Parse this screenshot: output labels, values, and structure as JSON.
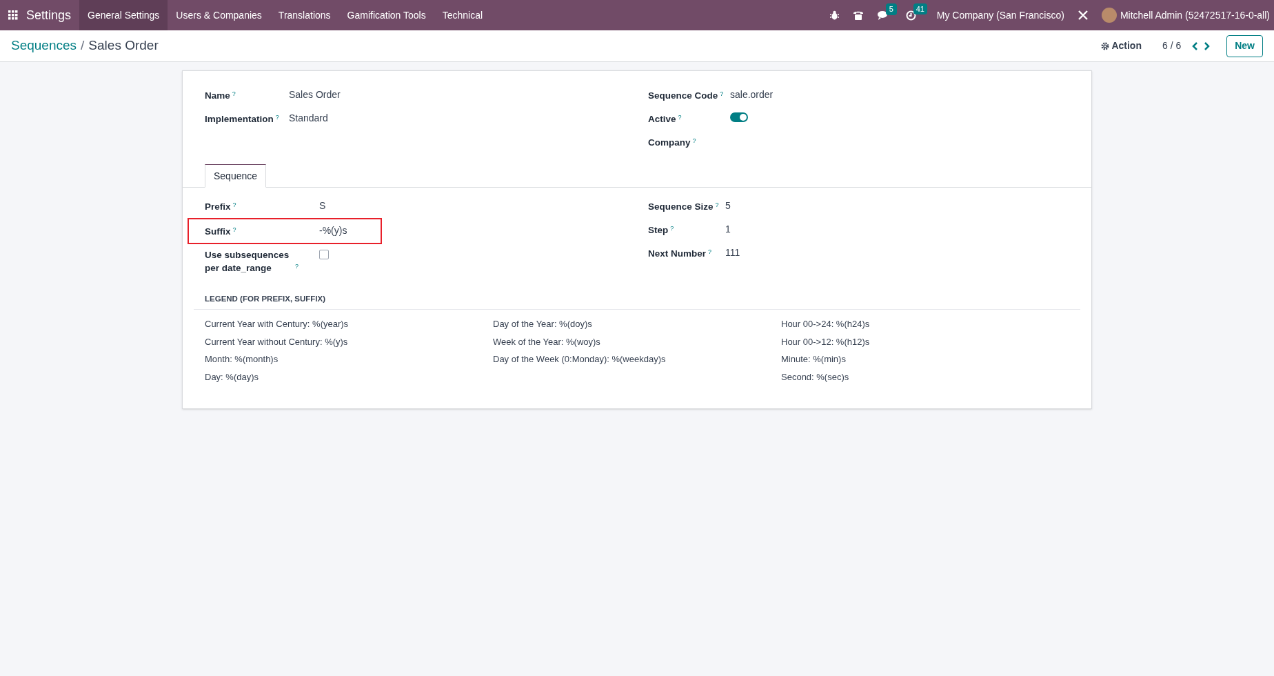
{
  "navbar": {
    "app_name": "Settings",
    "menus": [
      {
        "label": "General Settings",
        "selected": true
      },
      {
        "label": "Users & Companies",
        "selected": false
      },
      {
        "label": "Translations",
        "selected": false
      },
      {
        "label": "Gamification Tools",
        "selected": false
      },
      {
        "label": "Technical",
        "selected": false
      }
    ],
    "messages_count": "5",
    "activities_count": "41",
    "company": "My Company (San Francisco)",
    "user": "Mitchell Admin (52472517-16-0-all)"
  },
  "control_panel": {
    "breadcrumb": [
      {
        "label": "Sequences"
      },
      {
        "label": "Sales Order"
      }
    ],
    "separator": "/",
    "action": "Action",
    "pager": "6 / 6",
    "new_button": "New"
  },
  "form": {
    "left_fields": [
      {
        "kind": "text",
        "label": "Name",
        "help": "?",
        "value": "Sales Order"
      },
      {
        "kind": "text",
        "label": "Implementation",
        "help": "?",
        "value": "Standard"
      }
    ],
    "right_fields": [
      {
        "kind": "text",
        "label": "Sequence Code",
        "help": "?",
        "value": "sale.order"
      },
      {
        "kind": "toggle",
        "label": "Active",
        "help": "?",
        "on": true
      },
      {
        "kind": "empty",
        "label": "Company",
        "help": "?"
      }
    ],
    "tabs": [
      {
        "label": "Sequence",
        "selected": true
      }
    ],
    "tab_left_fields": [
      {
        "kind": "text",
        "label": "Prefix",
        "help": "?",
        "value": "S",
        "highlighted": false
      },
      {
        "kind": "text",
        "label": "Suffix",
        "help": "?",
        "value": "-%(y)s",
        "highlighted": true
      },
      {
        "kind": "checkbox",
        "label": "Use subsequences per date_range",
        "help": "?",
        "checked": false,
        "highlighted": false
      }
    ],
    "tab_right_fields": [
      {
        "kind": "text",
        "label": "Sequence Size",
        "help": "?",
        "value": "5"
      },
      {
        "kind": "text",
        "label": "Step",
        "help": "?",
        "value": "1"
      },
      {
        "kind": "text",
        "label": "Next Number",
        "help": "?",
        "value": "111"
      }
    ],
    "legend": {
      "title": "LEGEND (FOR PREFIX, SUFFIX)",
      "columns": [
        [
          "Current Year with Century: %(year)s",
          "Current Year without Century: %(y)s",
          "Month: %(month)s",
          "Day: %(day)s"
        ],
        [
          "Day of the Year: %(doy)s",
          "Week of the Year: %(woy)s",
          "Day of the Week (0:Monday): %(weekday)s"
        ],
        [
          "Hour 00->24: %(h24)s",
          "Hour 00->12: %(h12)s",
          "Minute: %(min)s",
          "Second: %(sec)s"
        ]
      ]
    }
  }
}
